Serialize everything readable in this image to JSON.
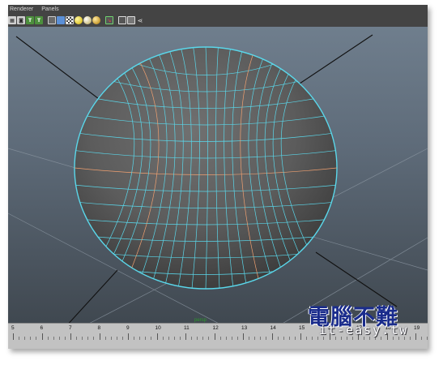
{
  "menu": {
    "items": [
      "Renderer",
      "Panels"
    ]
  },
  "toolbar": {
    "icons": [
      "wireframe-icon",
      "smooth-shade-icon",
      "bounding-box-icon",
      "texture-icon",
      "cube-icon",
      "shaded-cube-icon",
      "checker-icon",
      "light-icon",
      "default-light-icon",
      "all-lights-icon",
      "select-camera-icon",
      "wireframe-on-shaded-icon",
      "xray-icon",
      "share-icon"
    ],
    "labels": {
      "t1": "T",
      "t2": "T"
    }
  },
  "viewport": {
    "origin_label": "persp",
    "wire_color": "#5ad7ea",
    "edge_color": "#f0a070"
  },
  "timeline": {
    "ticks": [
      "5",
      "6",
      "7",
      "8",
      "9",
      "10",
      "11",
      "12",
      "13",
      "14",
      "15",
      "16",
      "17",
      "18",
      "19"
    ]
  },
  "watermark": {
    "title": "電腦不難",
    "subtitle": "it-easy.tw"
  }
}
